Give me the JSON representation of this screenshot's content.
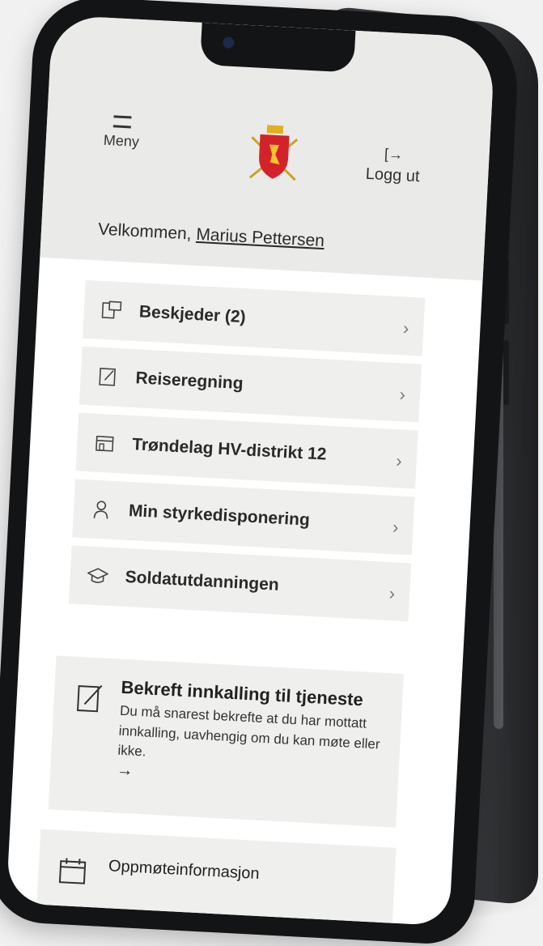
{
  "header": {
    "menu_label": "Meny",
    "logout_label": "Logg ut",
    "welcome_prefix": "Velkommen,",
    "user_name": "Marius Pettersen"
  },
  "menu_items": [
    {
      "label": "Beskjeder (2)",
      "icon": "messages-icon"
    },
    {
      "label": "Reiseregning",
      "icon": "document-edit-icon"
    },
    {
      "label": "Trøndelag HV-distrikt 12",
      "icon": "building-icon"
    },
    {
      "label": "Min styrkedisponering",
      "icon": "soldier-icon"
    },
    {
      "label": "Soldatutdanningen",
      "icon": "graduation-cap-icon"
    }
  ],
  "notice_card": {
    "title": "Bekreft innkalling til tjeneste",
    "body": "Du må snarest bekrefte at du har mottatt innkalling, uavhengig om du kan møte eller ikke.",
    "arrow": "→"
  },
  "info_card": {
    "title": "Oppmøteinformasjon"
  },
  "colors": {
    "header_bg": "#eaeae8",
    "item_bg": "#efefed",
    "text": "#2a2a2a"
  }
}
